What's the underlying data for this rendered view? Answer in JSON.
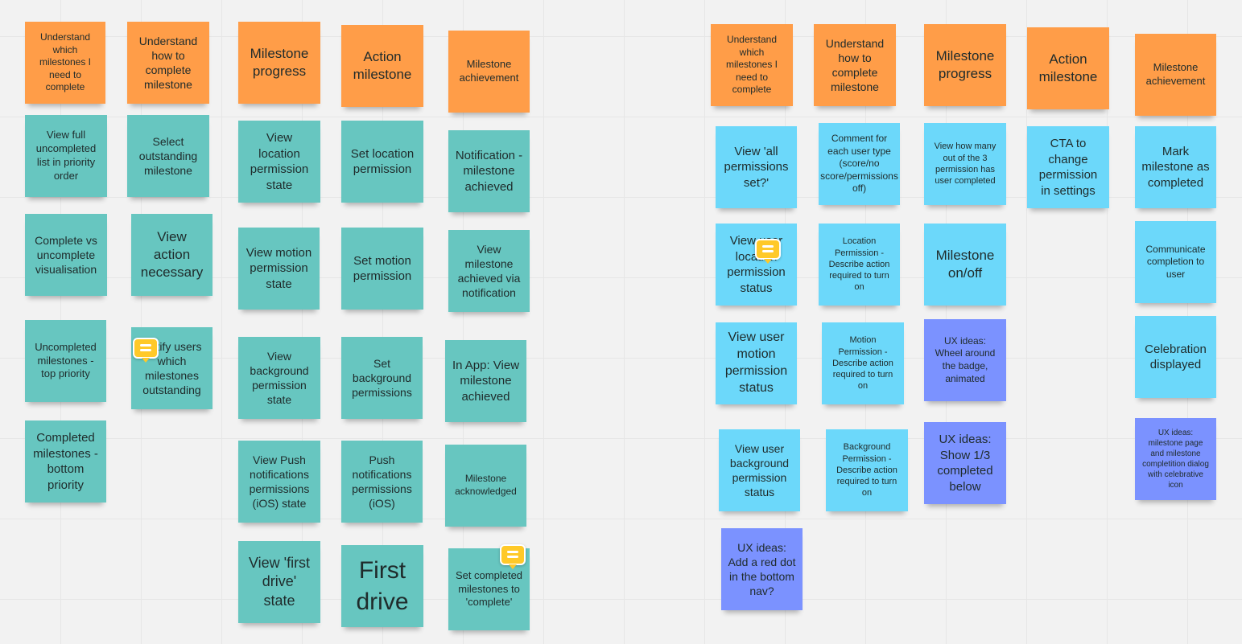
{
  "colors": {
    "orange": "#ff9d48",
    "teal": "#67c6c0",
    "blue": "#6cd8fa",
    "purple": "#7b92ff",
    "comment": "#ffc928"
  },
  "notes": [
    {
      "text": "Understand which milestones I need to complete",
      "color": "orange"
    },
    {
      "text": "View full uncompleted list in priority order",
      "color": "teal"
    },
    {
      "text": "Complete vs uncomplete visualisation",
      "color": "teal"
    },
    {
      "text": "Uncompleted milestones - top priority",
      "color": "teal"
    },
    {
      "text": "Completed milestones - bottom priority",
      "color": "teal"
    },
    {
      "text": "Understand how to complete milestone",
      "color": "orange"
    },
    {
      "text": "Select outstanding milestone",
      "color": "teal"
    },
    {
      "text": "View action necessary",
      "color": "teal"
    },
    {
      "text": "Notify users which milestones outstanding",
      "color": "teal"
    },
    {
      "text": "Milestone progress",
      "color": "orange"
    },
    {
      "text": "View location permission state",
      "color": "teal"
    },
    {
      "text": "View motion permission state",
      "color": "teal"
    },
    {
      "text": "View background permission state",
      "color": "teal"
    },
    {
      "text": "View Push notifications permissions (iOS) state",
      "color": "teal"
    },
    {
      "text": "View 'first drive' state",
      "color": "teal"
    },
    {
      "text": "Action milestone",
      "color": "orange"
    },
    {
      "text": "Set location permission",
      "color": "teal"
    },
    {
      "text": "Set motion permission",
      "color": "teal"
    },
    {
      "text": "Set background permissions",
      "color": "teal"
    },
    {
      "text": "Push notifications permissions (iOS)",
      "color": "teal"
    },
    {
      "text": "First drive",
      "color": "teal"
    },
    {
      "text": "Milestone achievement",
      "color": "orange"
    },
    {
      "text": "Notification - milestone achieved",
      "color": "teal"
    },
    {
      "text": "View milestone achieved via notification",
      "color": "teal"
    },
    {
      "text": "In App: View milestone achieved",
      "color": "teal"
    },
    {
      "text": "Milestone acknowledged",
      "color": "teal"
    },
    {
      "text": "Set completed milestones to 'complete'",
      "color": "teal"
    },
    {
      "text": "Understand which milestones I need to complete",
      "color": "orange"
    },
    {
      "text": "View 'all permissions set?'",
      "color": "blue"
    },
    {
      "text": "View user location permission status",
      "color": "blue"
    },
    {
      "text": "View user motion permission status",
      "color": "blue"
    },
    {
      "text": "View user background permission status",
      "color": "blue"
    },
    {
      "text": "UX ideas: Add a red dot in the bottom nav?",
      "color": "purple"
    },
    {
      "text": "Understand how to complete milestone",
      "color": "orange"
    },
    {
      "text": "Comment for each user type (score/no score/permissions off)",
      "color": "blue"
    },
    {
      "text": "Location Permission - Describe  action required to turn on",
      "color": "blue"
    },
    {
      "text": "Motion Permission - Describe  action required to turn on",
      "color": "blue"
    },
    {
      "text": "Background Permission - Describe  action required to turn on",
      "color": "blue"
    },
    {
      "text": "Milestone progress",
      "color": "orange"
    },
    {
      "text": "View how many out of the 3 permission has user completed",
      "color": "blue"
    },
    {
      "text": "Milestone on/off",
      "color": "blue"
    },
    {
      "text": "UX ideas: Wheel around the badge, animated",
      "color": "purple"
    },
    {
      "text": "UX ideas: Show 1/3 completed below",
      "color": "purple"
    },
    {
      "text": "Action milestone",
      "color": "orange"
    },
    {
      "text": "CTA to change permission in settings",
      "color": "blue"
    },
    {
      "text": "Milestone achievement",
      "color": "orange"
    },
    {
      "text": "Mark milestone as completed",
      "color": "blue"
    },
    {
      "text": "Communicate completion to user",
      "color": "blue"
    },
    {
      "text": "Celebration displayed",
      "color": "blue"
    },
    {
      "text": "UX ideas: milestone page and milestone completition dialog with celebrative icon",
      "color": "purple"
    }
  ],
  "comments": [
    {
      "icon": "comment-icon",
      "on_note": 8
    },
    {
      "icon": "comment-icon",
      "on_note": 26
    },
    {
      "icon": "comment-icon",
      "on_note": 29
    }
  ]
}
